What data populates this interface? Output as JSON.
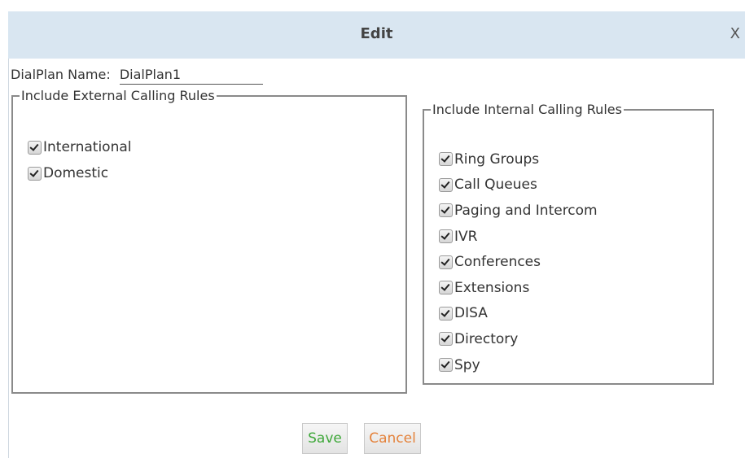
{
  "dialog": {
    "title": "Edit",
    "close_label": "X"
  },
  "dialplan": {
    "name_label": "DialPlan Name:",
    "name_value": "DialPlan1"
  },
  "external": {
    "legend": "Include External Calling Rules",
    "items": [
      {
        "label": "International",
        "checked": true
      },
      {
        "label": "Domestic",
        "checked": true
      }
    ]
  },
  "internal": {
    "legend": "Include Internal Calling Rules",
    "items": [
      {
        "label": "Ring Groups",
        "checked": true
      },
      {
        "label": "Call Queues",
        "checked": true
      },
      {
        "label": "Paging and Intercom",
        "checked": true
      },
      {
        "label": "IVR",
        "checked": true
      },
      {
        "label": "Conferences",
        "checked": true
      },
      {
        "label": "Extensions",
        "checked": true
      },
      {
        "label": "DISA",
        "checked": true
      },
      {
        "label": "Directory",
        "checked": true
      },
      {
        "label": "Spy",
        "checked": true
      }
    ]
  },
  "buttons": {
    "save_label": "Save",
    "cancel_label": "Cancel"
  },
  "colors": {
    "titlebar": "#d9e6f1",
    "save": "#3fa83a",
    "cancel": "#e4823b"
  }
}
